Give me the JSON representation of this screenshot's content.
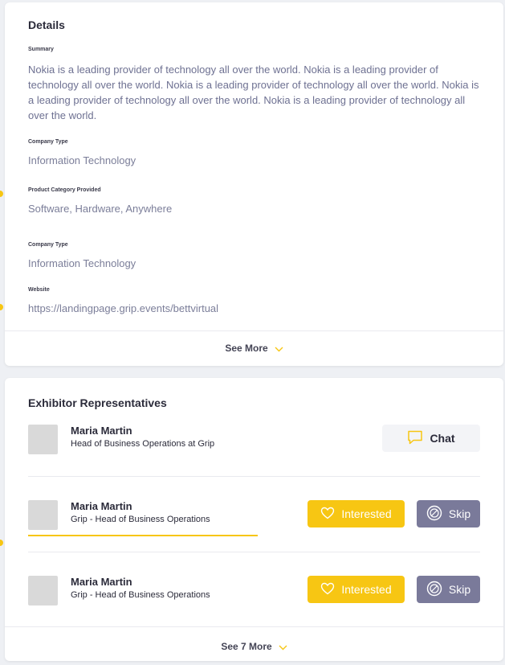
{
  "details": {
    "title": "Details",
    "summary_label": "Summary",
    "summary_text": "Nokia is a leading provider of technology all over the world. Nokia is a leading provider of technology all over the world. Nokia is a leading provider of technology all over the world. Nokia is a leading provider of technology all over the world. Nokia is a leading provider of technology all over the world.",
    "company_type_label": "Company Type",
    "company_type_value": "Information Technology",
    "product_category_label": "Product Category Provided",
    "product_category_value": "Software, Hardware, Anywhere",
    "company_type2_label": "Company Type",
    "company_type2_value": "Information Technology",
    "website_label": "Website",
    "website_value": "https://landingpage.grip.events/bettvirtual",
    "see_more_label": "See More"
  },
  "reps": {
    "title": "Exhibitor Representatives",
    "rows": [
      {
        "name": "Maria Martin",
        "role": "Head of Business Operations at Grip",
        "action": "Chat"
      },
      {
        "name": "Maria Martin",
        "role": "Grip - Head of Business Operations",
        "interested_label": "Interested",
        "skip_label": "Skip"
      },
      {
        "name": "Maria Martin",
        "role": "Grip - Head of Business Operations",
        "interested_label": "Interested",
        "skip_label": "Skip"
      }
    ],
    "see_more_label": "See 7 More"
  },
  "colors": {
    "accent": "#f7c613",
    "skip": "#7a7a9a",
    "muted_text": "#7b7e99"
  }
}
